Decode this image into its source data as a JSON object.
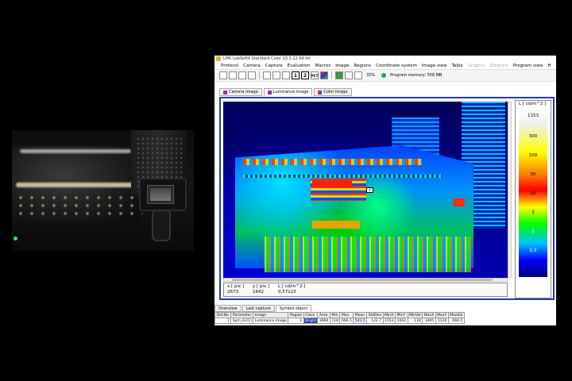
{
  "window": {
    "title": "LMK LabSoft4 Standard Color  23.3.22 64 bit"
  },
  "menu": [
    {
      "label": "Protocol",
      "disabled": false
    },
    {
      "label": "Camera",
      "disabled": false
    },
    {
      "label": "Capture",
      "disabled": false
    },
    {
      "label": "Evaluation",
      "disabled": false
    },
    {
      "label": "Macros",
      "disabled": false
    },
    {
      "label": "Image",
      "disabled": false
    },
    {
      "label": "Regions",
      "disabled": false
    },
    {
      "label": "Coordinate system",
      "disabled": false
    },
    {
      "label": "Image view",
      "disabled": false
    },
    {
      "label": "Table",
      "disabled": false
    },
    {
      "label": "Graphic",
      "disabled": true
    },
    {
      "label": "Diagram",
      "disabled": true
    },
    {
      "label": "Program view",
      "disabled": false
    },
    {
      "label": "H",
      "disabled": false
    }
  ],
  "toolbar": {
    "one_label": "1",
    "two_label": "2",
    "pct_label": "PCT",
    "zoom": "33%",
    "memory": "Program memory: 556 MB"
  },
  "image_tabs": [
    "Camera image",
    "Luminance image",
    "Color image"
  ],
  "image_marker": "1",
  "readout": {
    "x_label": "x  [ pix ]",
    "x_value": "2673",
    "y_label": "y  [ pix ]",
    "y_value": "1642",
    "l_label": "L  [ cd/m^2 ]",
    "l_value": "0,57123"
  },
  "legend": {
    "title": "L  [ cd/m^2 ]",
    "ticks": [
      "1153",
      "300",
      "100",
      "30",
      "10",
      "3",
      "1",
      "0,3"
    ]
  },
  "bottom_tabs": [
    "Overview",
    "Last capture",
    "Symbol object"
  ],
  "table": {
    "headers": [
      "Std.No.",
      "Parameter",
      "Image",
      "Region",
      "Class",
      "Area",
      "Min",
      "Max",
      "Mean",
      "StdDev",
      "MinX",
      "MinY",
      "MinVal",
      "MaxX",
      "MaxY",
      "MaxVal"
    ],
    "rows": [
      [
        "1",
        "Sym_Gr[1]",
        "Luminance image",
        "1",
        "Bright",
        "3960",
        "118",
        "666.5",
        "541.5",
        "122.7",
        "1553",
        "1042",
        "118",
        "1495",
        "1129",
        "666.5"
      ]
    ]
  },
  "colors": {
    "accent": "#2a3ca8",
    "status_ok": "#2ba23e",
    "class_bg": "#2b45b0"
  }
}
